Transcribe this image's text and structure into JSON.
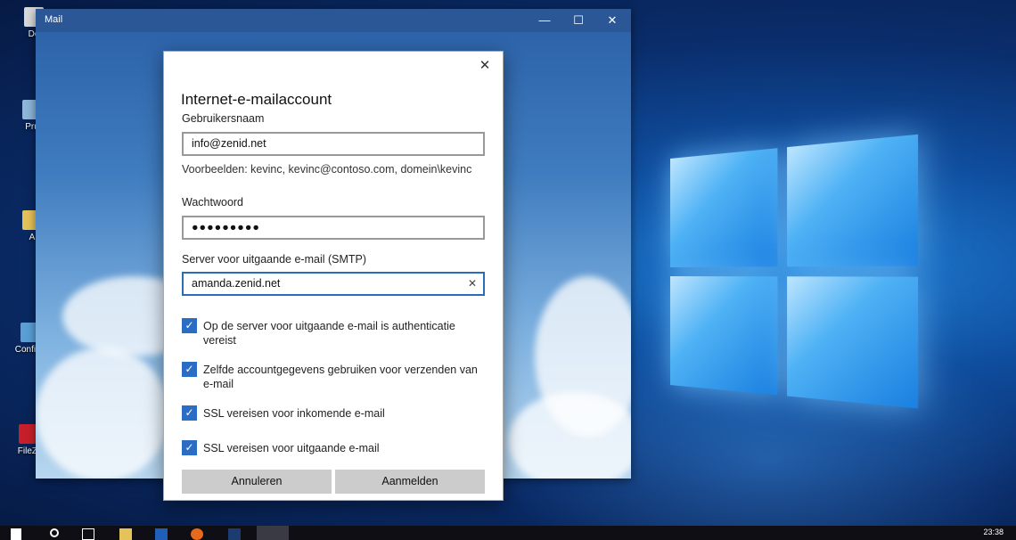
{
  "desktop": {
    "icons": [
      {
        "label": "De",
        "color": "#d9d9d9"
      },
      {
        "label": "Pru",
        "color": "#8fb7d9"
      },
      {
        "label": "A",
        "color": "#e6c35a"
      },
      {
        "label": "Configu",
        "color": "#5aa0d6"
      },
      {
        "label": "FileZi",
        "color": "#c8202a"
      }
    ]
  },
  "mail_window": {
    "title": "Mail",
    "minimize_glyph": "—",
    "maximize_glyph": "☐",
    "close_glyph": "✕"
  },
  "dialog": {
    "close_glyph": "✕",
    "title": "Internet-e-mailaccount",
    "username": {
      "label": "Gebruikersnaam",
      "value": "info@zenid.net",
      "hint": "Voorbeelden: kevinc, kevinc@contoso.com, domein\\kevinc"
    },
    "password": {
      "label": "Wachtwoord",
      "value": "●●●●●●●●●"
    },
    "smtp": {
      "label": "Server voor uitgaande e-mail (SMTP)",
      "value": "amanda.zenid.net",
      "clear_glyph": "✕"
    },
    "checkboxes": [
      {
        "label": "Op de server voor uitgaande e-mail is authenticatie vereist",
        "checked": true
      },
      {
        "label": "Zelfde accountgegevens gebruiken voor verzenden van e-mail",
        "checked": true
      },
      {
        "label": "SSL vereisen voor inkomende e-mail",
        "checked": true
      },
      {
        "label": "SSL vereisen voor uitgaande e-mail",
        "checked": true
      }
    ],
    "check_glyph": "✓",
    "cancel_label": "Annuleren",
    "submit_label": "Aanmelden"
  },
  "taskbar": {
    "clock": "23:38",
    "accent": "#0e0e14"
  }
}
